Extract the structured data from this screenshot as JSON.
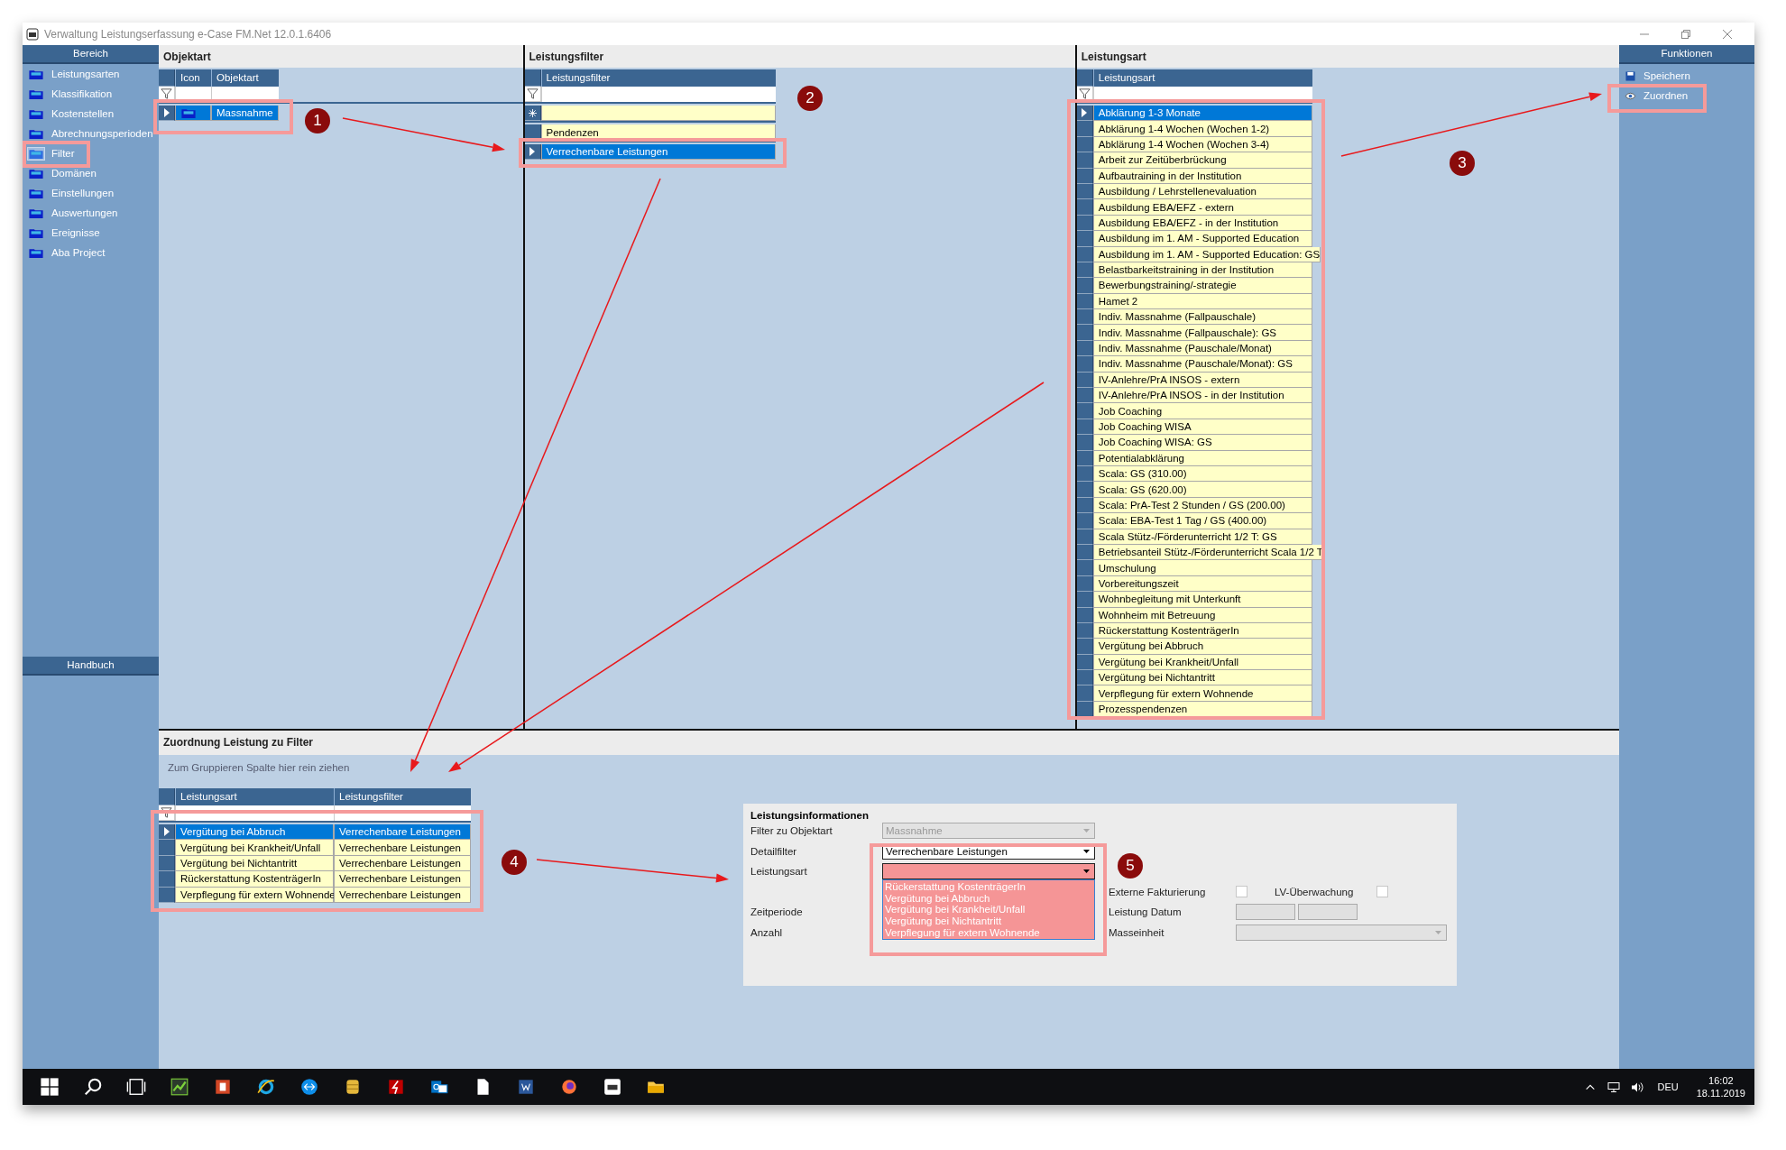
{
  "window": {
    "title": "Verwaltung Leistungserfassung e-Case FM.Net 12.0.1.6406"
  },
  "sidebar": {
    "header": "Bereich",
    "footer": "Handbuch",
    "items": [
      {
        "label": "Leistungsarten",
        "selected": false
      },
      {
        "label": "Klassifikation",
        "selected": false
      },
      {
        "label": "Kostenstellen",
        "selected": false
      },
      {
        "label": "Abrechnungsperioden",
        "selected": false
      },
      {
        "label": "Filter",
        "selected": true
      },
      {
        "label": "Domänen",
        "selected": false
      },
      {
        "label": "Einstellungen",
        "selected": false
      },
      {
        "label": "Auswertungen",
        "selected": false
      },
      {
        "label": "Ereignisse",
        "selected": false
      },
      {
        "label": "Aba Project",
        "selected": false
      }
    ]
  },
  "objektart": {
    "title": "Objektart",
    "columns": [
      "Icon",
      "Objektart"
    ],
    "rows": [
      {
        "objektart": "Massnahme",
        "selected": true
      }
    ]
  },
  "leistungsfilter": {
    "title": "Leistungsfilter",
    "columns": [
      "Leistungsfilter"
    ],
    "rows": [
      {
        "label": "Pendenzen",
        "selected": false
      },
      {
        "label": "Verrechenbare Leistungen",
        "selected": true
      }
    ]
  },
  "leistungsart": {
    "title": "Leistungsart",
    "columns": [
      "Leistungsart"
    ],
    "rows": [
      {
        "label": "Abklärung 1-3 Monate",
        "selected": true
      },
      {
        "label": "Abklärung 1-4 Wochen (Wochen 1-2)",
        "selected": false
      },
      {
        "label": "Abklärung 1-4 Wochen (Wochen 3-4)",
        "selected": false
      },
      {
        "label": "Arbeit zur Zeitüberbrückung",
        "selected": false
      },
      {
        "label": "Aufbautraining in der Institution",
        "selected": false
      },
      {
        "label": "Ausbildung / Lehrstellenevaluation",
        "selected": false
      },
      {
        "label": "Ausbildung EBA/EFZ - extern",
        "selected": false
      },
      {
        "label": "Ausbildung EBA/EFZ - in der Institution",
        "selected": false
      },
      {
        "label": "Ausbildung im 1. AM - Supported Education",
        "selected": false
      },
      {
        "label": "Ausbildung im 1. AM - Supported Education: GS",
        "selected": false
      },
      {
        "label": "Belastbarkeitstraining in der Institution",
        "selected": false
      },
      {
        "label": "Bewerbungstraining/-strategie",
        "selected": false
      },
      {
        "label": "Hamet 2",
        "selected": false
      },
      {
        "label": "Indiv. Massnahme (Fallpauschale)",
        "selected": false
      },
      {
        "label": "Indiv. Massnahme (Fallpauschale): GS",
        "selected": false
      },
      {
        "label": "Indiv. Massnahme (Pauschale/Monat)",
        "selected": false
      },
      {
        "label": "Indiv. Massnahme (Pauschale/Monat): GS",
        "selected": false
      },
      {
        "label": "IV-Anlehre/PrA INSOS - extern",
        "selected": false
      },
      {
        "label": "IV-Anlehre/PrA INSOS - in der Institution",
        "selected": false
      },
      {
        "label": "Job Coaching",
        "selected": false
      },
      {
        "label": "Job Coaching WISA",
        "selected": false
      },
      {
        "label": "Job Coaching WISA: GS",
        "selected": false
      },
      {
        "label": "Potentialabklärung",
        "selected": false
      },
      {
        "label": "Scala: GS (310.00)",
        "selected": false
      },
      {
        "label": "Scala: GS (620.00)",
        "selected": false
      },
      {
        "label": "Scala: PrA-Test 2 Stunden / GS (200.00)",
        "selected": false
      },
      {
        "label": "Scala: EBA-Test 1 Tag / GS (400.00)",
        "selected": false
      },
      {
        "label": "Scala Stütz-/Förderunterricht 1/2 T: GS",
        "selected": false
      },
      {
        "label": "Betriebsanteil Stütz-/Förderunterricht Scala 1/2 T",
        "selected": false
      },
      {
        "label": "Umschulung",
        "selected": false
      },
      {
        "label": "Vorbereitungszeit",
        "selected": false
      },
      {
        "label": "Wohnbegleitung mit Unterkunft",
        "selected": false
      },
      {
        "label": "Wohnheim mit Betreuung",
        "selected": false
      },
      {
        "label": "Rückerstattung KostenträgerIn",
        "selected": false
      },
      {
        "label": "Vergütung bei Abbruch",
        "selected": false
      },
      {
        "label": "Vergütung bei Krankheit/Unfall",
        "selected": false
      },
      {
        "label": "Vergütung bei Nichtantritt",
        "selected": false
      },
      {
        "label": "Verpflegung für extern Wohnende",
        "selected": false
      },
      {
        "label": "Prozesspendenzen",
        "selected": false
      }
    ]
  },
  "functions": {
    "header": "Funktionen",
    "items": [
      {
        "label": "Speichern",
        "kind": "save"
      },
      {
        "label": "Zuordnen",
        "kind": "assign"
      }
    ]
  },
  "assignment": {
    "title": "Zuordnung Leistung zu Filter",
    "group_hint": "Zum Gruppieren Spalte hier rein ziehen",
    "columns": [
      "Leistungsart",
      "Leistungsfilter"
    ],
    "rows": [
      {
        "leistungsart": "Vergütung bei Abbruch",
        "leistungsfilter": "Verrechenbare Leistungen",
        "selected": true
      },
      {
        "leistungsart": "Vergütung bei Krankheit/Unfall",
        "leistungsfilter": "Verrechenbare Leistungen",
        "selected": false
      },
      {
        "leistungsart": "Vergütung bei Nichtantritt",
        "leistungsfilter": "Verrechenbare Leistungen",
        "selected": false
      },
      {
        "leistungsart": "Rückerstattung KostenträgerIn",
        "leistungsfilter": "Verrechenbare Leistungen",
        "selected": false
      },
      {
        "leistungsart": "Verpflegung für extern Wohnende",
        "leistungsfilter": "Verrechenbare Leistungen",
        "selected": false
      }
    ]
  },
  "info": {
    "title": "Leistungsinformationen",
    "filter_objektart": {
      "label": "Filter zu Objektart",
      "value": "Massnahme",
      "disabled": true
    },
    "detailfilter": {
      "label": "Detailfilter",
      "value": "Verrechenbare Leistungen",
      "disabled": false
    },
    "leistungsart": {
      "label": "Leistungsart",
      "expanded": true,
      "options": [
        "Rückerstattung KostenträgerIn",
        "Vergütung bei Abbruch",
        "Vergütung bei Krankheit/Unfall",
        "Vergütung bei Nichtantritt",
        "Verpflegung für extern Wohnende"
      ]
    },
    "externe_fakturierung": {
      "label": "Externe Fakturierung",
      "checked": false
    },
    "lv_ueberwachung": {
      "label": "LV-Überwachung",
      "checked": false
    },
    "zeitperiode": {
      "label": "Zeitperiode"
    },
    "leistung_datum": {
      "label": "Leistung Datum"
    },
    "anzahl": {
      "label": "Anzahl"
    },
    "masseinheit": {
      "label": "Masseinheit",
      "disabled": true
    }
  },
  "taskbar": {
    "language": "DEU",
    "time": "16:02",
    "date": "18.11.2019"
  },
  "callouts": [
    "1",
    "2",
    "3",
    "4",
    "5"
  ]
}
